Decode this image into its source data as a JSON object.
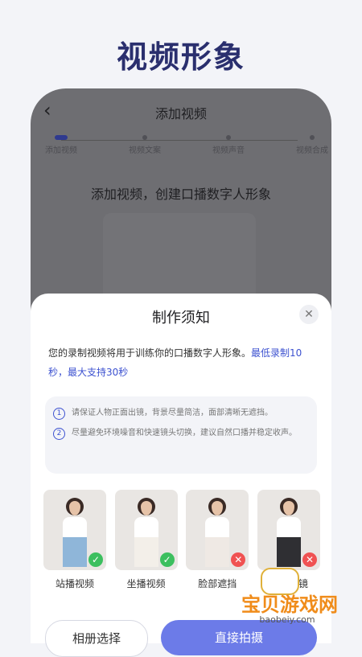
{
  "headline": "视频形象",
  "screen": {
    "nav_title": "添加视频",
    "steps": [
      "添加视频",
      "视频文案",
      "视频声音",
      "视频合成"
    ],
    "main_text": "添加视频，创建口播数字人形象"
  },
  "sheet": {
    "title": "制作须知",
    "desc_plain": "您的录制视频将用于训练你的口播数字人形象。",
    "desc_highlight": "最低录制10秒，最大支持30秒",
    "tips": [
      {
        "num": "1",
        "text": "请保证人物正面出镜，背景尽量简洁，面部清晰无遮挡。"
      },
      {
        "num": "2",
        "text": "尽量避免环境噪音和快速镜头切换，建议自然口播并稳定收声。"
      }
    ],
    "examples": [
      {
        "label": "站播视频",
        "status": "ok",
        "mark": "✓",
        "top": "#ffffff",
        "bottom": "#8fb6d9"
      },
      {
        "label": "坐播视频",
        "status": "ok",
        "mark": "✓",
        "top": "#ffffff",
        "bottom": "#f3efe9"
      },
      {
        "label": "脸部遮挡",
        "status": "no",
        "mark": "✕",
        "top": "#ffffff",
        "bottom": "#efe9e4"
      },
      {
        "label": "多人出镜",
        "status": "no",
        "mark": "✕",
        "top": "#ffffff",
        "bottom": "#2f2f33"
      }
    ],
    "btn_album": "相册选择",
    "btn_shoot": "直接拍摄",
    "close_icon": "close-icon"
  },
  "watermark": {
    "text": "宝贝游戏网",
    "url": "baobeiy.com"
  },
  "colors": {
    "accent": "#3d52d0",
    "primary_button": "#6c7be8",
    "ok": "#3cbf5f",
    "no": "#f05252"
  }
}
